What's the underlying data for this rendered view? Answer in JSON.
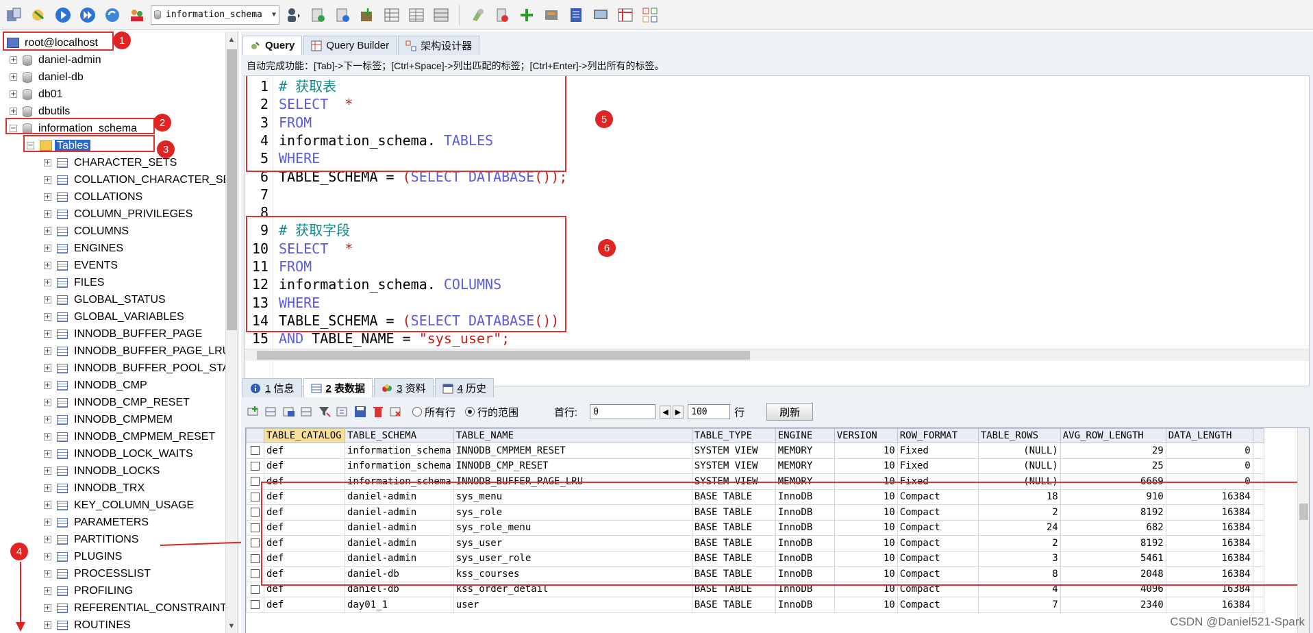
{
  "toolbar": {
    "database_select": "information_schema",
    "icons": [
      "connect-icon",
      "new-connection-icon",
      "execute-icon",
      "execute-all-icon",
      "refresh-icon",
      "user-manager-icon",
      "user-icon",
      "backup-icon",
      "restore-icon",
      "import-icon",
      "schema-icon",
      "table-data-icon",
      "sync-icon",
      "query-builder-icon",
      "schedule-icon",
      "tools-icon",
      "export-icon",
      "report-icon",
      "designer-icon"
    ]
  },
  "object_browser": {
    "root": "root@localhost",
    "databases": [
      "daniel-admin",
      "daniel-db",
      "db01",
      "dbutils",
      "information_schema"
    ],
    "tables_folder": "Tables",
    "tables": [
      "CHARACTER_SETS",
      "COLLATION_CHARACTER_SET_",
      "COLLATIONS",
      "COLUMN_PRIVILEGES",
      "COLUMNS",
      "ENGINES",
      "EVENTS",
      "FILES",
      "GLOBAL_STATUS",
      "GLOBAL_VARIABLES",
      "INNODB_BUFFER_PAGE",
      "INNODB_BUFFER_PAGE_LRU",
      "INNODB_BUFFER_POOL_STAT:",
      "INNODB_CMP",
      "INNODB_CMP_RESET",
      "INNODB_CMPMEM",
      "INNODB_CMPMEM_RESET",
      "INNODB_LOCK_WAITS",
      "INNODB_LOCKS",
      "INNODB_TRX",
      "KEY_COLUMN_USAGE",
      "PARAMETERS",
      "PARTITIONS",
      "PLUGINS",
      "PROCESSLIST",
      "PROFILING",
      "REFERENTIAL_CONSTRAINTS",
      "ROUTINES"
    ]
  },
  "annotations": {
    "badges": [
      "1",
      "2",
      "3",
      "4",
      "5",
      "6"
    ],
    "color": "#e02424"
  },
  "editor_tabs": [
    "Query",
    "Query Builder",
    "架构设计器"
  ],
  "hint": "自动完成功能：[Tab]->下一标签；[Ctrl+Space]->列出匹配的标签；[Ctrl+Enter]->列出所有的标签。",
  "code_lines": [
    {
      "n": "1",
      "parts": [
        {
          "t": "# 获取表",
          "c": "cmt"
        }
      ]
    },
    {
      "n": "2",
      "parts": [
        {
          "t": "SELECT",
          "c": "kw"
        },
        {
          "t": "  *",
          "c": "str"
        }
      ]
    },
    {
      "n": "3",
      "parts": [
        {
          "t": "FROM",
          "c": "kw"
        }
      ]
    },
    {
      "n": "4",
      "parts": [
        {
          "t": "information_schema. ",
          "c": ""
        },
        {
          "t": "TABLES",
          "c": "kw"
        }
      ]
    },
    {
      "n": "5",
      "parts": [
        {
          "t": "WHERE",
          "c": "kw"
        }
      ]
    },
    {
      "n": "6",
      "parts": [
        {
          "t": "TABLE_SCHEMA = ",
          "c": ""
        },
        {
          "t": "(",
          "c": "str"
        },
        {
          "t": "SELECT DATABASE",
          "c": "kw"
        },
        {
          "t": "());",
          "c": "str"
        }
      ]
    },
    {
      "n": "7",
      "parts": []
    },
    {
      "n": "8",
      "parts": []
    },
    {
      "n": "9",
      "parts": [
        {
          "t": "# 获取字段",
          "c": "cmt"
        }
      ]
    },
    {
      "n": "10",
      "parts": [
        {
          "t": "SELECT",
          "c": "kw"
        },
        {
          "t": "  *",
          "c": "str"
        }
      ]
    },
    {
      "n": "11",
      "parts": [
        {
          "t": "FROM",
          "c": "kw"
        }
      ]
    },
    {
      "n": "12",
      "parts": [
        {
          "t": "information_schema. ",
          "c": ""
        },
        {
          "t": "COLUMNS",
          "c": "kw"
        }
      ]
    },
    {
      "n": "13",
      "parts": [
        {
          "t": "WHERE",
          "c": "kw"
        }
      ]
    },
    {
      "n": "14",
      "parts": [
        {
          "t": "TABLE_SCHEMA = ",
          "c": ""
        },
        {
          "t": "(",
          "c": "str"
        },
        {
          "t": "SELECT DATABASE",
          "c": "kw"
        },
        {
          "t": "())",
          "c": "str"
        }
      ]
    },
    {
      "n": "15",
      "parts": [
        {
          "t": "AND ",
          "c": "kw"
        },
        {
          "t": "TABLE_NAME = ",
          "c": ""
        },
        {
          "t": "\"sys_user\";",
          "c": "str"
        }
      ]
    }
  ],
  "result_tabs": [
    {
      "num": "1",
      "label": "信息"
    },
    {
      "num": "2",
      "label": "表数据"
    },
    {
      "num": "3",
      "label": "资料"
    },
    {
      "num": "4",
      "label": "历史"
    }
  ],
  "result_toolbar": {
    "radio_all": "所有行",
    "radio_range": "行的范围",
    "first_row_label": "首行:",
    "first_row_value": "0",
    "count_value": "100",
    "rows_label": "行",
    "refresh": "刷新"
  },
  "grid": {
    "columns": [
      "TABLE_CATALOG",
      "TABLE_SCHEMA",
      "TABLE_NAME",
      "TABLE_TYPE",
      "ENGINE",
      "VERSION",
      "ROW_FORMAT",
      "TABLE_ROWS",
      "AVG_ROW_LENGTH",
      "DATA_LENGTH"
    ],
    "rows": [
      [
        "def",
        "information_schema",
        "INNODB_CMPMEM_RESET",
        "SYSTEM VIEW",
        "MEMORY",
        "10",
        "Fixed",
        "(NULL)",
        "29",
        "0"
      ],
      [
        "def",
        "information_schema",
        "INNODB_CMP_RESET",
        "SYSTEM VIEW",
        "MEMORY",
        "10",
        "Fixed",
        "(NULL)",
        "25",
        "0"
      ],
      [
        "def",
        "information_schema",
        "INNODB_BUFFER_PAGE_LRU",
        "SYSTEM VIEW",
        "MEMORY",
        "10",
        "Fixed",
        "(NULL)",
        "6669",
        "0"
      ],
      [
        "def",
        "daniel-admin",
        "sys_menu",
        "BASE TABLE",
        "InnoDB",
        "10",
        "Compact",
        "18",
        "910",
        "16384"
      ],
      [
        "def",
        "daniel-admin",
        "sys_role",
        "BASE TABLE",
        "InnoDB",
        "10",
        "Compact",
        "2",
        "8192",
        "16384"
      ],
      [
        "def",
        "daniel-admin",
        "sys_role_menu",
        "BASE TABLE",
        "InnoDB",
        "10",
        "Compact",
        "24",
        "682",
        "16384"
      ],
      [
        "def",
        "daniel-admin",
        "sys_user",
        "BASE TABLE",
        "InnoDB",
        "10",
        "Compact",
        "2",
        "8192",
        "16384"
      ],
      [
        "def",
        "daniel-admin",
        "sys_user_role",
        "BASE TABLE",
        "InnoDB",
        "10",
        "Compact",
        "3",
        "5461",
        "16384"
      ],
      [
        "def",
        "daniel-db",
        "kss_courses",
        "BASE TABLE",
        "InnoDB",
        "10",
        "Compact",
        "8",
        "2048",
        "16384"
      ],
      [
        "def",
        "daniel-db",
        "kss_order_detail",
        "BASE TABLE",
        "InnoDB",
        "10",
        "Compact",
        "4",
        "4096",
        "16384"
      ],
      [
        "def",
        "day01_1",
        "user",
        "BASE TABLE",
        "InnoDB",
        "10",
        "Compact",
        "7",
        "2340",
        "16384"
      ]
    ]
  },
  "watermark": "CSDN @Daniel521-Spark"
}
